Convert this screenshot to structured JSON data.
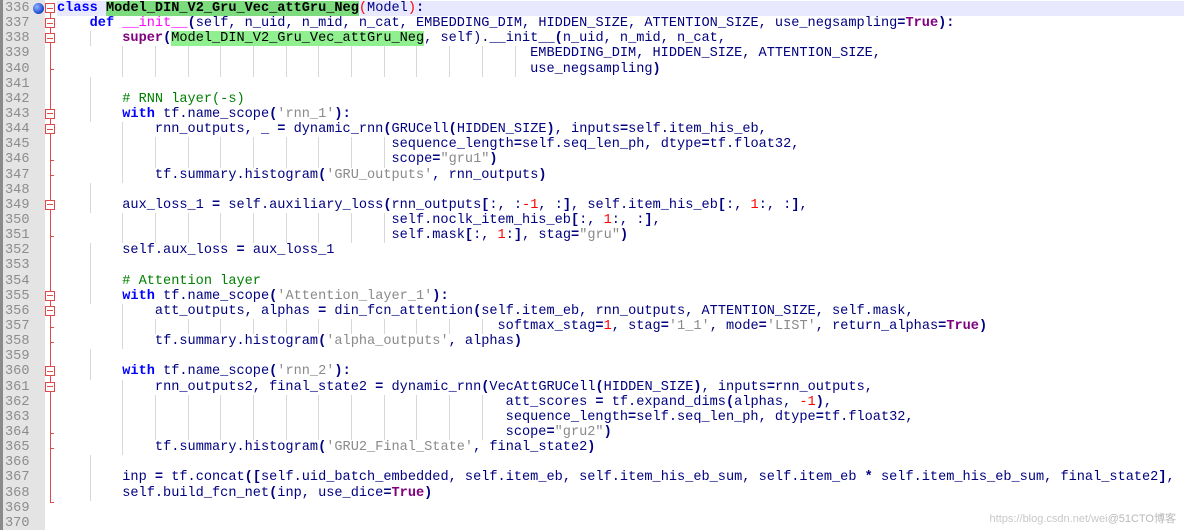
{
  "editor": {
    "current_line": 336,
    "bookmark_line": 336,
    "lines": [
      {
        "n": "336",
        "tokens": [
          [
            "kw",
            "class"
          ],
          [
            "t",
            " "
          ],
          [
            "cls",
            "Model_DIN_V2_Gru_Vec_attGru_Neg"
          ],
          [
            "paren-red",
            "("
          ],
          [
            "tk",
            "Model"
          ],
          [
            "paren-red",
            ")"
          ],
          [
            "op",
            ":"
          ]
        ]
      },
      {
        "n": "337",
        "tokens": [
          [
            "t",
            "    "
          ],
          [
            "kw",
            "def"
          ],
          [
            "t",
            " "
          ],
          [
            "fn",
            "__init__"
          ],
          [
            "op",
            "("
          ],
          [
            "tk",
            "self, n_uid, n_mid, n_cat, EMBEDDING_DIM, HIDDEN_SIZE, ATTENTION_SIZE, use_negsampling"
          ],
          [
            "op",
            "="
          ],
          [
            "kw2",
            "True"
          ],
          [
            "op",
            "):"
          ]
        ]
      },
      {
        "n": "338",
        "tokens": [
          [
            "t",
            "        "
          ],
          [
            "kw2",
            "super"
          ],
          [
            "op",
            "("
          ],
          [
            "clsref",
            "Model_DIN_V2_Gru_Vec_attGru_Neg"
          ],
          [
            "tk",
            ", self)."
          ],
          [
            "tk",
            "__init__"
          ],
          [
            "op",
            "("
          ],
          [
            "tk",
            "n_uid, n_mid, n_cat,"
          ]
        ]
      },
      {
        "n": "339",
        "tokens": [
          [
            "t",
            "                                                          "
          ],
          [
            "tk",
            "EMBEDDING_DIM, HIDDEN_SIZE, ATTENTION_SIZE,"
          ]
        ]
      },
      {
        "n": "340",
        "tokens": [
          [
            "t",
            "                                                          "
          ],
          [
            "tk",
            "use_negsampling"
          ],
          [
            "op",
            ")"
          ]
        ]
      },
      {
        "n": "341",
        "tokens": []
      },
      {
        "n": "342",
        "tokens": [
          [
            "t",
            "        "
          ],
          [
            "cmt",
            "# RNN layer(-s)"
          ]
        ]
      },
      {
        "n": "343",
        "tokens": [
          [
            "t",
            "        "
          ],
          [
            "kw",
            "with"
          ],
          [
            "tk",
            " tf.name_scope"
          ],
          [
            "op",
            "("
          ],
          [
            "str",
            "'rnn_1'"
          ],
          [
            "op",
            "):"
          ]
        ]
      },
      {
        "n": "344",
        "tokens": [
          [
            "t",
            "            "
          ],
          [
            "tk",
            "rnn_outputs, _ "
          ],
          [
            "op",
            "="
          ],
          [
            "tk",
            " dynamic_rnn"
          ],
          [
            "op",
            "("
          ],
          [
            "tk",
            "GRUCell"
          ],
          [
            "op",
            "("
          ],
          [
            "tk",
            "HIDDEN_SIZE"
          ],
          [
            "op",
            ")"
          ],
          [
            "tk",
            ", inputs"
          ],
          [
            "op",
            "="
          ],
          [
            "tk",
            "self.item_his_eb,"
          ]
        ]
      },
      {
        "n": "345",
        "tokens": [
          [
            "t",
            "                                         "
          ],
          [
            "tk",
            "sequence_length"
          ],
          [
            "op",
            "="
          ],
          [
            "tk",
            "self.seq_len_ph, dtype"
          ],
          [
            "op",
            "="
          ],
          [
            "tk",
            "tf.float32,"
          ]
        ]
      },
      {
        "n": "346",
        "tokens": [
          [
            "t",
            "                                         "
          ],
          [
            "tk",
            "scope"
          ],
          [
            "op",
            "="
          ],
          [
            "str",
            "\"gru1\""
          ],
          [
            "op",
            ")"
          ]
        ]
      },
      {
        "n": "347",
        "tokens": [
          [
            "t",
            "            "
          ],
          [
            "tk",
            "tf.summary.histogram"
          ],
          [
            "op",
            "("
          ],
          [
            "str",
            "'GRU_outputs'"
          ],
          [
            "tk",
            ", rnn_outputs"
          ],
          [
            "op",
            ")"
          ]
        ]
      },
      {
        "n": "348",
        "tokens": []
      },
      {
        "n": "349",
        "tokens": [
          [
            "t",
            "        "
          ],
          [
            "tk",
            "aux_loss_1 "
          ],
          [
            "op",
            "="
          ],
          [
            "tk",
            " self.auxiliary_loss"
          ],
          [
            "op",
            "("
          ],
          [
            "tk",
            "rnn_outputs"
          ],
          [
            "op",
            "["
          ],
          [
            "tk",
            ":, :"
          ],
          [
            "num",
            "-1"
          ],
          [
            "tk",
            ", :"
          ],
          [
            "op",
            "]"
          ],
          [
            "tk",
            ", self.item_his_eb"
          ],
          [
            "op",
            "["
          ],
          [
            "tk",
            ":, "
          ],
          [
            "num",
            "1"
          ],
          [
            "tk",
            ":, :"
          ],
          [
            "op",
            "]"
          ],
          [
            "tk",
            ","
          ]
        ]
      },
      {
        "n": "350",
        "tokens": [
          [
            "t",
            "                                         "
          ],
          [
            "tk",
            "self.noclk_item_his_eb"
          ],
          [
            "op",
            "["
          ],
          [
            "tk",
            ":, "
          ],
          [
            "num",
            "1"
          ],
          [
            "tk",
            ":, :"
          ],
          [
            "op",
            "]"
          ],
          [
            "tk",
            ","
          ]
        ]
      },
      {
        "n": "351",
        "tokens": [
          [
            "t",
            "                                         "
          ],
          [
            "tk",
            "self.mask"
          ],
          [
            "op",
            "["
          ],
          [
            "tk",
            ":, "
          ],
          [
            "num",
            "1"
          ],
          [
            "tk",
            ":"
          ],
          [
            "op",
            "]"
          ],
          [
            "tk",
            ", stag"
          ],
          [
            "op",
            "="
          ],
          [
            "str",
            "\"gru\""
          ],
          [
            "op",
            ")"
          ]
        ]
      },
      {
        "n": "352",
        "tokens": [
          [
            "t",
            "        "
          ],
          [
            "tk",
            "self.aux_loss "
          ],
          [
            "op",
            "="
          ],
          [
            "tk",
            " aux_loss_1"
          ]
        ]
      },
      {
        "n": "353",
        "tokens": []
      },
      {
        "n": "354",
        "tokens": [
          [
            "t",
            "        "
          ],
          [
            "cmt",
            "# Attention layer"
          ]
        ]
      },
      {
        "n": "355",
        "tokens": [
          [
            "t",
            "        "
          ],
          [
            "kw",
            "with"
          ],
          [
            "tk",
            " tf.name_scope"
          ],
          [
            "op",
            "("
          ],
          [
            "str",
            "'Attention_layer_1'"
          ],
          [
            "op",
            "):"
          ]
        ]
      },
      {
        "n": "356",
        "tokens": [
          [
            "t",
            "            "
          ],
          [
            "tk",
            "att_outputs, alphas "
          ],
          [
            "op",
            "="
          ],
          [
            "tk",
            " din_fcn_attention"
          ],
          [
            "op",
            "("
          ],
          [
            "tk",
            "self.item_eb, rnn_outputs, ATTENTION_SIZE, self.mask,"
          ]
        ]
      },
      {
        "n": "357",
        "tokens": [
          [
            "t",
            "                                                      "
          ],
          [
            "tk",
            "softmax_stag"
          ],
          [
            "op",
            "="
          ],
          [
            "num",
            "1"
          ],
          [
            "tk",
            ", stag"
          ],
          [
            "op",
            "="
          ],
          [
            "str",
            "'1_1'"
          ],
          [
            "tk",
            ", mode"
          ],
          [
            "op",
            "="
          ],
          [
            "str",
            "'LIST'"
          ],
          [
            "tk",
            ", return_alphas"
          ],
          [
            "op",
            "="
          ],
          [
            "kw2",
            "True"
          ],
          [
            "op",
            ")"
          ]
        ]
      },
      {
        "n": "358",
        "tokens": [
          [
            "t",
            "            "
          ],
          [
            "tk",
            "tf.summary.histogram"
          ],
          [
            "op",
            "("
          ],
          [
            "str",
            "'alpha_outputs'"
          ],
          [
            "tk",
            ", alphas"
          ],
          [
            "op",
            ")"
          ]
        ]
      },
      {
        "n": "359",
        "tokens": []
      },
      {
        "n": "360",
        "tokens": [
          [
            "t",
            "        "
          ],
          [
            "kw",
            "with"
          ],
          [
            "tk",
            " tf.name_scope"
          ],
          [
            "op",
            "("
          ],
          [
            "str",
            "'rnn_2'"
          ],
          [
            "op",
            "):"
          ]
        ]
      },
      {
        "n": "361",
        "tokens": [
          [
            "t",
            "            "
          ],
          [
            "tk",
            "rnn_outputs2, final_state2 "
          ],
          [
            "op",
            "="
          ],
          [
            "tk",
            " dynamic_rnn"
          ],
          [
            "op",
            "("
          ],
          [
            "tk",
            "VecAttGRUCell"
          ],
          [
            "op",
            "("
          ],
          [
            "tk",
            "HIDDEN_SIZE"
          ],
          [
            "op",
            ")"
          ],
          [
            "tk",
            ", inputs"
          ],
          [
            "op",
            "="
          ],
          [
            "tk",
            "rnn_outputs,"
          ]
        ]
      },
      {
        "n": "362",
        "tokens": [
          [
            "t",
            "                                                       "
          ],
          [
            "tk",
            "att_scores "
          ],
          [
            "op",
            "="
          ],
          [
            "tk",
            " tf.expand_dims"
          ],
          [
            "op",
            "("
          ],
          [
            "tk",
            "alphas, "
          ],
          [
            "num",
            "-1"
          ],
          [
            "op",
            ")"
          ],
          [
            "tk",
            ","
          ]
        ]
      },
      {
        "n": "363",
        "tokens": [
          [
            "t",
            "                                                       "
          ],
          [
            "tk",
            "sequence_length"
          ],
          [
            "op",
            "="
          ],
          [
            "tk",
            "self.seq_len_ph, dtype"
          ],
          [
            "op",
            "="
          ],
          [
            "tk",
            "tf.float32,"
          ]
        ]
      },
      {
        "n": "364",
        "tokens": [
          [
            "t",
            "                                                       "
          ],
          [
            "tk",
            "scope"
          ],
          [
            "op",
            "="
          ],
          [
            "str",
            "\"gru2\""
          ],
          [
            "op",
            ")"
          ]
        ]
      },
      {
        "n": "365",
        "tokens": [
          [
            "t",
            "            "
          ],
          [
            "tk",
            "tf.summary.histogram"
          ],
          [
            "op",
            "("
          ],
          [
            "str",
            "'GRU2_Final_State'"
          ],
          [
            "tk",
            ", final_state2"
          ],
          [
            "op",
            ")"
          ]
        ]
      },
      {
        "n": "366",
        "tokens": []
      },
      {
        "n": "367",
        "tokens": [
          [
            "t",
            "        "
          ],
          [
            "tk",
            "inp "
          ],
          [
            "op",
            "="
          ],
          [
            "tk",
            " tf.concat"
          ],
          [
            "op",
            "(["
          ],
          [
            "tk",
            "self.uid_batch_embedded, self.item_eb, self.item_his_eb_sum, self.item_eb "
          ],
          [
            "op",
            "*"
          ],
          [
            "tk",
            " self.item_his_eb_sum, final_state2"
          ],
          [
            "op",
            "]"
          ],
          [
            "tk",
            ","
          ]
        ]
      },
      {
        "n": "368",
        "tokens": [
          [
            "t",
            "        "
          ],
          [
            "tk",
            "self.build_fcn_net"
          ],
          [
            "op",
            "("
          ],
          [
            "tk",
            "inp, use_dice"
          ],
          [
            "op",
            "="
          ],
          [
            "kw2",
            "True"
          ],
          [
            "op",
            ")"
          ]
        ]
      },
      {
        "n": "369",
        "tokens": []
      },
      {
        "n": "370",
        "tokens": []
      }
    ]
  },
  "watermark": {
    "url": "https://blog.csdn.net/wei",
    "brand": "@51CTO博客"
  }
}
